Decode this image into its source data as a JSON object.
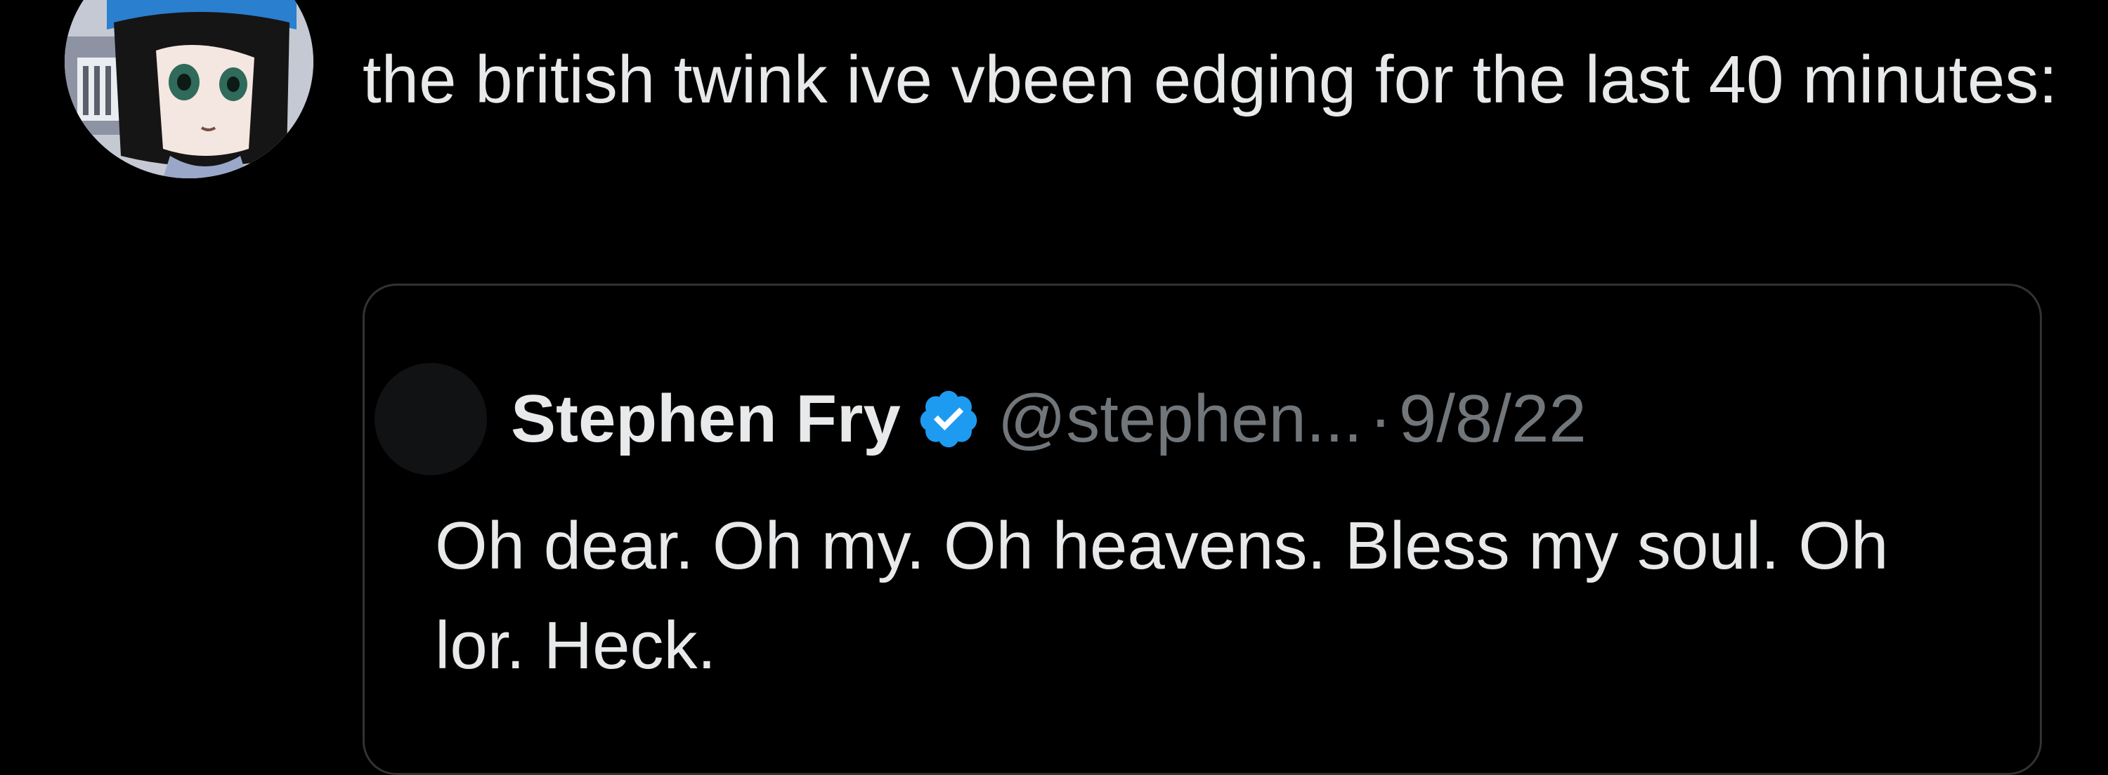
{
  "tweet": {
    "author_name": "",
    "author_handle": "",
    "text": "the british twink ive vbeen edging for the last 40 minutes:",
    "avatar_icon": "anime-character-avatar"
  },
  "quoted_tweet": {
    "author_name": "Stephen Fry",
    "verified_icon": "verified-badge-icon",
    "verified_color": "#1d9bf0",
    "author_handle": "@stephen...",
    "separator": "·",
    "date": "9/8/22",
    "text": "Oh dear. Oh my. Oh heavens. Bless my soul. Oh lor. Heck."
  },
  "colors": {
    "background": "#000000",
    "text_primary": "#e7e9ea",
    "text_secondary": "#71767b",
    "card_border": "#2f3336"
  }
}
